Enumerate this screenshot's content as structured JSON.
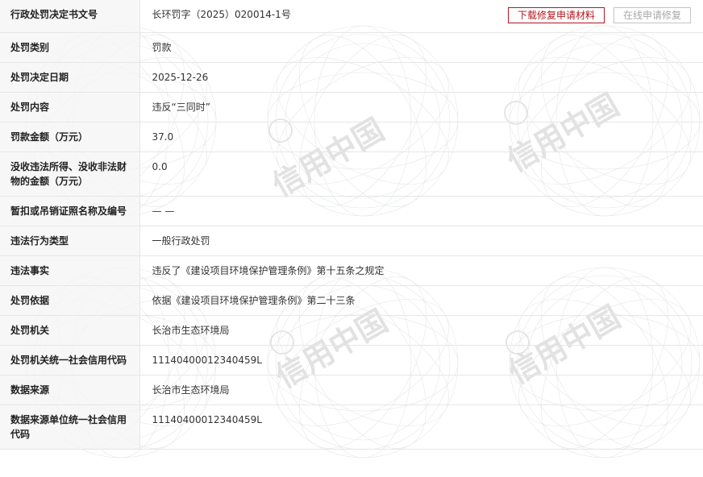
{
  "buttons": {
    "download": "下载修复申请材料",
    "online": "在线申请修复"
  },
  "watermark_text": "信用中国",
  "rows": [
    {
      "label": "行政处罚决定书文号",
      "value": "长环罚字（2025）020014-1号"
    },
    {
      "label": "处罚类别",
      "value": "罚款"
    },
    {
      "label": "处罚决定日期",
      "value": "2025-12-26"
    },
    {
      "label": "处罚内容",
      "value": "违反“三同时”"
    },
    {
      "label": "罚款金额（万元）",
      "value": "37.0"
    },
    {
      "label": "没收违法所得、没收非法财物的金额（万元）",
      "value": "0.0"
    },
    {
      "label": "暂扣或吊销证照名称及编号",
      "value": "— —"
    },
    {
      "label": "违法行为类型",
      "value": "一般行政处罚"
    },
    {
      "label": "违法事实",
      "value": "违反了《建设项目环境保护管理条例》第十五条之规定"
    },
    {
      "label": "处罚依据",
      "value": "依据《建设项目环境保护管理条例》第二十三条"
    },
    {
      "label": "处罚机关",
      "value": "长治市生态环境局"
    },
    {
      "label": "处罚机关统一社会信用代码",
      "value": "11140400012340459L"
    },
    {
      "label": "数据来源",
      "value": "长治市生态环境局"
    },
    {
      "label": "数据来源单位统一社会信用代码",
      "value": "11140400012340459L"
    }
  ],
  "colors": {
    "accent_red": "#b4161b",
    "label_bg": "#f5f5f5",
    "border": "#e6e6e6"
  }
}
